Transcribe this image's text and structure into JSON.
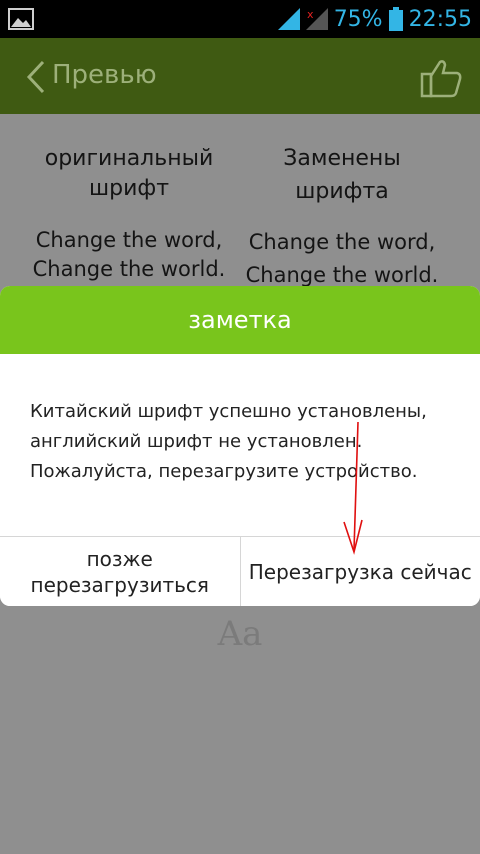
{
  "status_bar": {
    "battery_percent": "75%",
    "time": "22:55",
    "icons": [
      "image-icon",
      "signal-icon",
      "signal-no-sim-icon",
      "battery-icon"
    ],
    "accent_color": "#33b5e5"
  },
  "app_bar": {
    "title": "Превью",
    "back_icon": "chevron-left-icon",
    "like_icon": "thumbs-up-icon"
  },
  "preview": {
    "left_label_line1": "оригинальный",
    "left_label_line2": "шрифт",
    "left_sample_line1": "Change the word,",
    "left_sample_line2": "Change the world.",
    "right_label_line1": "Заменены",
    "right_label_line2": "шрифта",
    "right_sample_line1": "Change the word,",
    "right_sample_line2": "Change the world.",
    "font_sample": "Aa"
  },
  "dialog": {
    "title": "заметка",
    "message_line1": "Китайский шрифт успешно установлены,",
    "message_line2": "английский шрифт не установлен.",
    "message_line3": "Пожалуйста, перезагрузите устройство.",
    "later_line1": "позже",
    "later_line2": "перезагрузиться",
    "now_label": "Перезагрузка сейчас",
    "header_color": "#79c51c"
  }
}
